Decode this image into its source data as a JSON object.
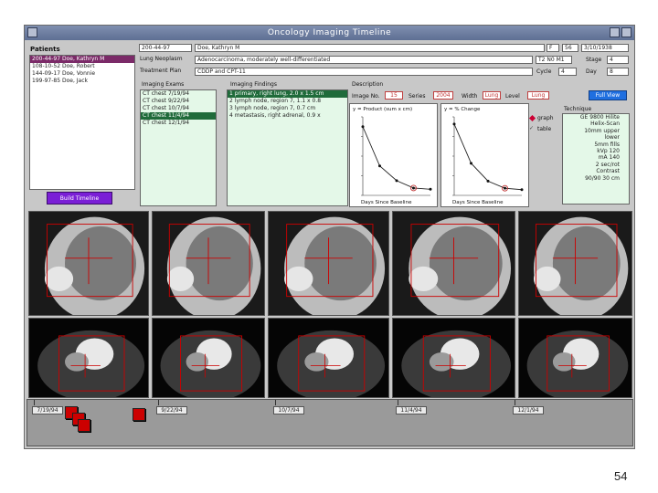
{
  "window": {
    "title": "Oncology Imaging Timeline"
  },
  "patients": {
    "label": "Patients",
    "items": [
      {
        "text": "200-44-97  Doe, Kathryn M",
        "selected": true
      },
      {
        "text": "108-10-52  Doe, Robert",
        "selected": false
      },
      {
        "text": "144-09-17  Doe, Vonnie",
        "selected": false
      },
      {
        "text": "199-97-85  Doe, Jack",
        "selected": false
      }
    ]
  },
  "header": {
    "mrn": "200-44-97",
    "name": "Doe, Kathryn M",
    "sex": "F",
    "age": "56",
    "date": "3/10/1938",
    "tumor_label": "Lung Neoplasm",
    "tumor_value": "Adenocarcinoma, moderately well-differentiated",
    "tnm_label": "T2 N0 M1",
    "stage_label": "Stage",
    "stage_value": "4",
    "treatment_label": "Treatment Plan",
    "treatment_value": "CDDP and CPT-11",
    "cycle_label": "Cycle",
    "cycle_value": "4",
    "day_label": "Day",
    "day_value": "8"
  },
  "exams": {
    "label": "Imaging Exams",
    "items": [
      {
        "text": "CT chest 7/19/94",
        "selected": false
      },
      {
        "text": "CT chest 9/22/94",
        "selected": false
      },
      {
        "text": "CT chest 10/7/94",
        "selected": false
      },
      {
        "text": "CT chest 11/4/94",
        "selected": true
      },
      {
        "text": "CT chest 12/1/94",
        "selected": false
      }
    ]
  },
  "findings": {
    "label": "Imaging Findings",
    "items": [
      {
        "text": "1  primary, right lung, 2.0 x 1.5 cm",
        "selected": true
      },
      {
        "text": "2  lymph node, region 7, 1.1 x 0.8",
        "selected": false
      },
      {
        "text": "3  lymph node, region 7, 0.7 cm",
        "selected": false
      },
      {
        "text": "4  metastasis, right adrenal, 0.9 x",
        "selected": false
      }
    ]
  },
  "description": {
    "label": "Description",
    "image_no_label": "Image No.",
    "image_no": "15",
    "series_label": "Series",
    "series": "2004",
    "width_label": "Width",
    "width": "Lung",
    "level_label": "Level",
    "level": "Lung",
    "full_view": "Full View"
  },
  "chart_data": [
    {
      "type": "line",
      "title": "y = Product (sum x cm)",
      "xlabel": "Days Since Baseline",
      "x": [
        0,
        1,
        2,
        3,
        4
      ],
      "values": [
        2.8,
        1.2,
        0.6,
        0.3,
        0.25
      ],
      "ylim": [
        0,
        3.2
      ],
      "color": "#222222",
      "marker_color": "#c03030"
    },
    {
      "type": "line",
      "title": "y = % Change",
      "xlabel": "Days Since Baseline",
      "x": [
        0,
        1,
        2,
        3,
        4
      ],
      "values": [
        0,
        -55,
        -80,
        -90,
        -92
      ],
      "ylim": [
        -100,
        10
      ],
      "color": "#222222",
      "marker_color": "#c03030"
    }
  ],
  "view_options": {
    "graph_label": "graph",
    "table_label": "table"
  },
  "technique": {
    "label": "Technique",
    "lines": [
      "GE 9800 Hilite",
      "Helix-Scan",
      "10mm upper",
      "lower",
      "5mm fills",
      "kVp 120",
      "mA 140",
      "2 sec/rot",
      "Contrast",
      "90/90 30 cm"
    ]
  },
  "build_button": {
    "label": "Build Timeline"
  },
  "timeline": {
    "labels": [
      "7/19/94",
      "9/22/94",
      "10/7/94",
      "11/4/94",
      "12/1/94"
    ]
  },
  "footer": {
    "page_number": "54"
  },
  "colors": {
    "accent_purple": "#7a1fd6",
    "selection_green": "#1f6b3a",
    "selection_magenta": "#7b2a68",
    "marker_red": "#cc0000"
  }
}
